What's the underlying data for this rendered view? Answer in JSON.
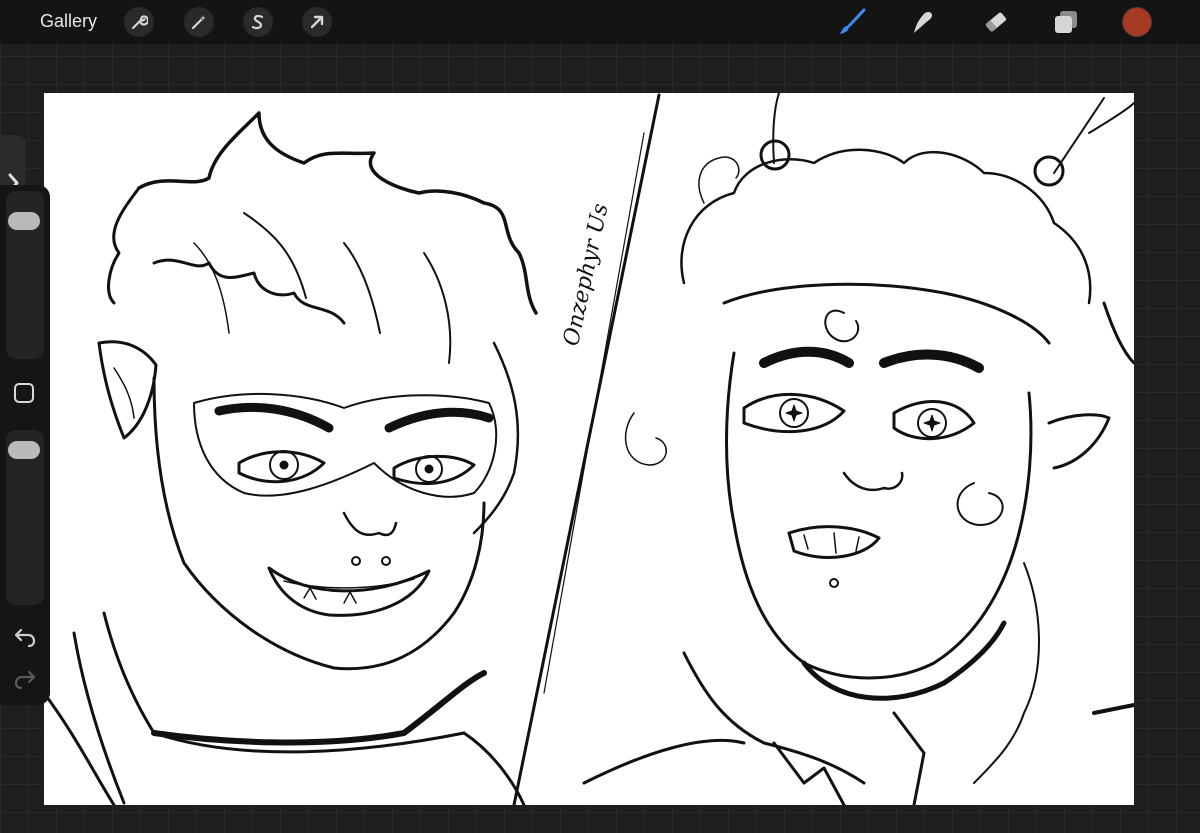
{
  "topbar": {
    "gallery_label": "Gallery",
    "actions": [
      {
        "name": "wrench-icon"
      },
      {
        "name": "magic-wand-icon"
      },
      {
        "name": "selection-s-icon"
      },
      {
        "name": "transform-arrow-icon"
      }
    ],
    "tools": [
      {
        "name": "brush-icon",
        "active": true,
        "color": "#3d8bf0"
      },
      {
        "name": "smudge-icon"
      },
      {
        "name": "eraser-icon"
      },
      {
        "name": "layers-icon"
      }
    ],
    "current_color": "#a63a22"
  },
  "sidebar": {
    "brush_size_level": 0.12,
    "opacity_level": 0.05,
    "undo_icon": "undo-icon",
    "redo_icon": "redo-icon",
    "expand_icon": "chevron-right-icon",
    "modify_icon": "square-modify-icon"
  },
  "canvas": {
    "signature": "Onzephyr Us"
  },
  "colors": {
    "accent": "#3d8bf0",
    "toolbar_bg": "#141414",
    "workspace_bg": "#1e1e1e"
  }
}
